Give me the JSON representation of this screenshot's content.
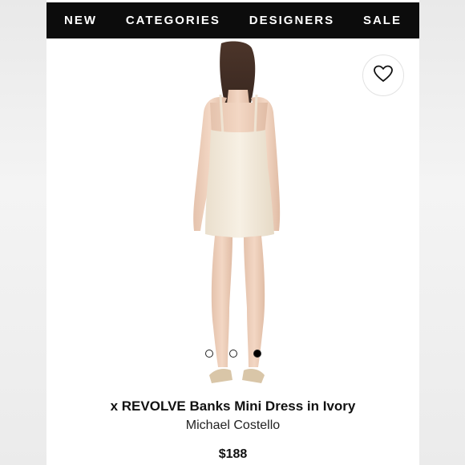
{
  "nav": {
    "items": [
      {
        "label": "NEW"
      },
      {
        "label": "CATEGORIES"
      },
      {
        "label": "DESIGNERS"
      },
      {
        "label": "SALE"
      }
    ]
  },
  "product": {
    "title": "x REVOLVE Banks Mini Dress in Ivory",
    "designer": "Michael Costello",
    "price": "$188",
    "image_icon": "dress-back-photo",
    "favorite_icon": "heart-icon"
  },
  "carousel": {
    "total": 3,
    "active_index": 2
  },
  "colors": {
    "nav_background": "#0c0c0c",
    "nav_text": "#ffffff",
    "dress": "#f3ebdd"
  }
}
